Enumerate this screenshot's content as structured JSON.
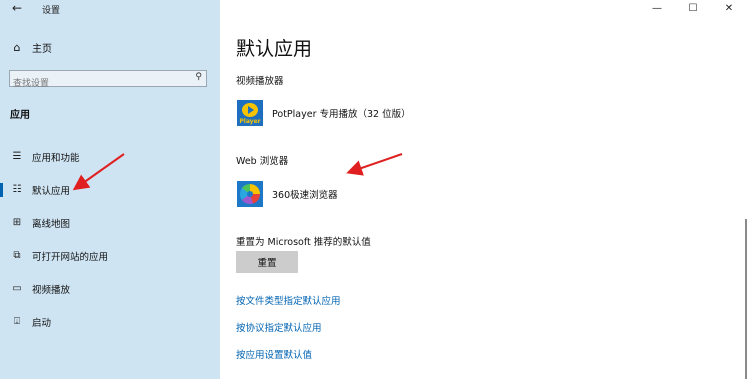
{
  "app": {
    "title": "设置",
    "back_glyph": "←"
  },
  "window_controls": {
    "minimize": "—",
    "maximize": "☐",
    "close": "✕"
  },
  "sidebar": {
    "home_label": "主页",
    "search_placeholder": "查找设置",
    "section_heading": "应用",
    "items": [
      {
        "label": "应用和功能",
        "icon": "list-icon",
        "glyph": "☰"
      },
      {
        "label": "默认应用",
        "icon": "default-apps-icon",
        "glyph": "☷",
        "active": true
      },
      {
        "label": "离线地图",
        "icon": "map-icon",
        "glyph": "⊞"
      },
      {
        "label": "可打开网站的应用",
        "icon": "web-app-icon",
        "glyph": "⧉"
      },
      {
        "label": "视频播放",
        "icon": "video-icon",
        "glyph": "▭"
      },
      {
        "label": "启动",
        "icon": "startup-icon",
        "glyph": "⍗"
      }
    ]
  },
  "main": {
    "title": "默认应用",
    "video_player": {
      "label": "视频播放器",
      "app_name": "PotPlayer 专用播放（32 位版）",
      "icon_text": "Player"
    },
    "web_browser": {
      "label": "Web 浏览器",
      "app_name": "360极速浏览器"
    },
    "reset": {
      "label": "重置为 Microsoft 推荐的默认值",
      "button": "重置"
    },
    "links": [
      "按文件类型指定默认应用",
      "按协议指定默认应用",
      "按应用设置默认值"
    ]
  },
  "colors": {
    "sidebar_bg": "#cfe4f3",
    "accent": "#0063b1",
    "arrow": "#e02020"
  }
}
